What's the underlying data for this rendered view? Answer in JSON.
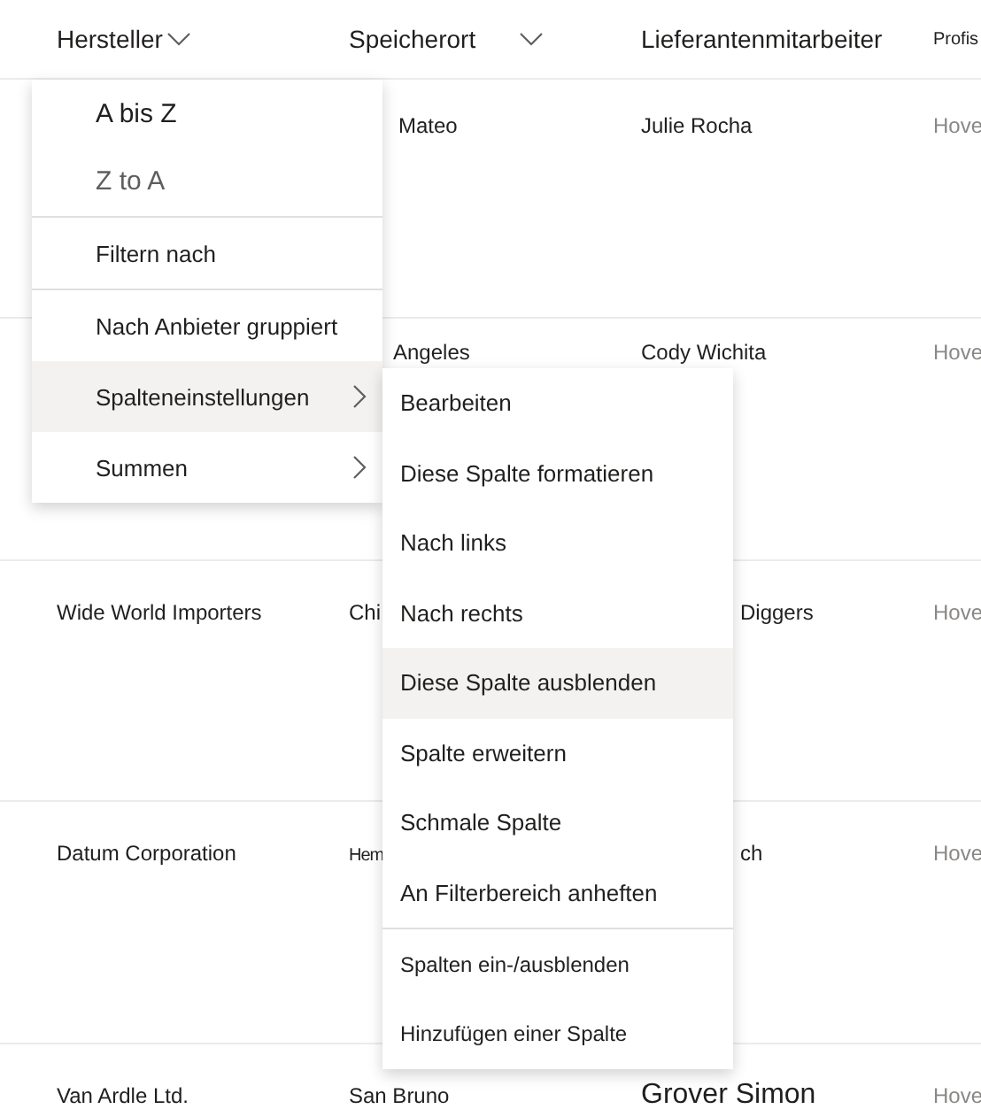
{
  "table": {
    "columns": [
      {
        "label": "Hersteller",
        "dropdown": true
      },
      {
        "label": "Speicherort",
        "dropdown": true
      },
      {
        "label": "Lieferantenmitarbeiter",
        "dropdown": false
      },
      {
        "label": "Profis",
        "dropdown": false
      }
    ],
    "rows": [
      {
        "cells": [
          "",
          "Mateo",
          "Julie Rocha",
          "Hove"
        ]
      },
      {
        "cells": [
          "",
          "Angeles",
          "Cody Wichita",
          "Hove"
        ]
      },
      {
        "cells": [
          "Wide World Importers",
          "Chi",
          "Diggers",
          "Hove"
        ]
      },
      {
        "cells": [
          "Datum Corporation",
          "Hem",
          "ch",
          "Hove"
        ]
      },
      {
        "cells": [
          "Van Ardle Ltd.",
          "San  Bruno",
          "Grover Simon",
          "Hove"
        ]
      }
    ]
  },
  "column_menu": {
    "groups": [
      [
        {
          "label": "A bis Z",
          "disabled": false,
          "selected": false,
          "submenu": false
        },
        {
          "label": "Z to A",
          "disabled": true,
          "selected": false,
          "submenu": false
        }
      ],
      [
        {
          "label": "Filtern nach",
          "disabled": false,
          "selected": false,
          "submenu": false
        }
      ],
      [
        {
          "label": "Nach Anbieter gruppiert",
          "disabled": false,
          "selected": false,
          "submenu": false
        },
        {
          "label": "Spalteneinstellungen",
          "disabled": false,
          "selected": true,
          "submenu": true
        },
        {
          "label": "Summen",
          "disabled": false,
          "selected": false,
          "submenu": true
        }
      ]
    ]
  },
  "settings_submenu": {
    "groups": [
      [
        {
          "label": "Bearbeiten",
          "selected": false
        },
        {
          "label": "Diese Spalte formatieren",
          "selected": false
        },
        {
          "label": "Nach links",
          "selected": false
        },
        {
          "label": "Nach rechts",
          "selected": false
        },
        {
          "label": "Diese Spalte ausblenden",
          "selected": true
        },
        {
          "label": "Spalte erweitern",
          "selected": false
        },
        {
          "label": "Schmale Spalte",
          "selected": false
        },
        {
          "label": "An Filterbereich anheften",
          "selected": false
        }
      ],
      [
        {
          "label": "Spalten ein-/ausblenden",
          "selected": false
        },
        {
          "label": "Hinzufügen einer Spalte",
          "selected": false
        }
      ]
    ]
  }
}
